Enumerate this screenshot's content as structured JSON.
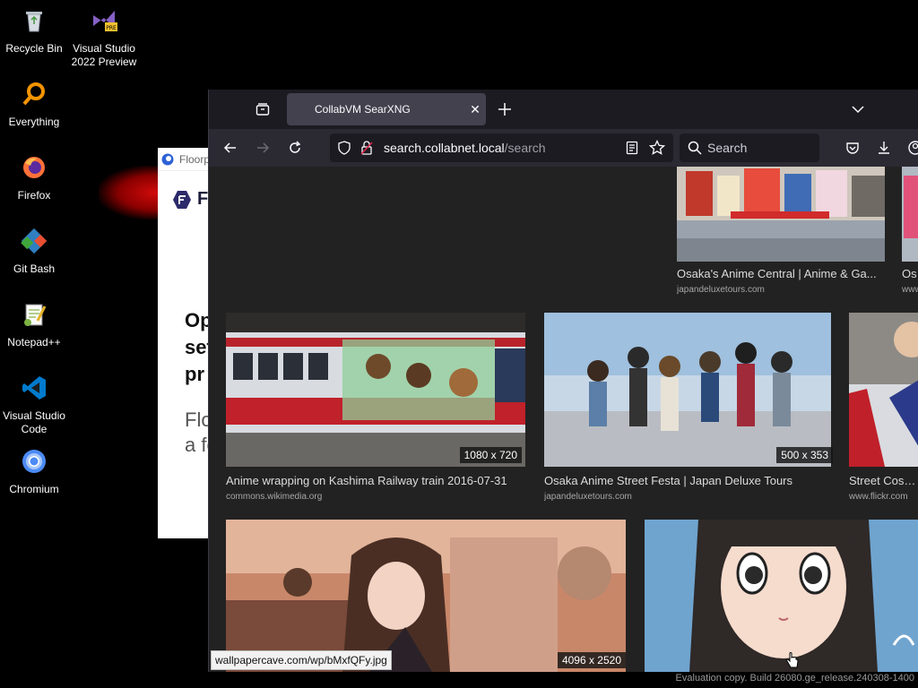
{
  "desktop": {
    "icons": [
      {
        "label": "Recycle Bin"
      },
      {
        "label": "Visual Studio 2022 Preview",
        "badge": "PRE"
      },
      {
        "label": "Everything"
      },
      {
        "label": "Firefox"
      },
      {
        "label": "Git Bash"
      },
      {
        "label": "Notepad++"
      },
      {
        "label": "Visual Studio Code"
      },
      {
        "label": "Chromium"
      }
    ]
  },
  "floorp": {
    "title": "Floorp",
    "logo_letter": "F",
    "headline": "Op\nset\npr",
    "subtext": "Flo\na fe"
  },
  "browser": {
    "tab": {
      "title": "CollabVM SearXNG"
    },
    "url": {
      "domain": "search.collabnet.local",
      "path": "/search"
    },
    "search_placeholder": "Search",
    "results": [
      {
        "title": "Osaka's Anime Central | Anime & Ga...",
        "source": "japandeluxetours.com",
        "resolution": ""
      },
      {
        "title": "Os",
        "source": "www",
        "resolution": ""
      },
      {
        "title": "Anime wrapping on Kashima Railway train 2016-07-31",
        "source": "commons.wikimedia.org",
        "resolution": "1080 x 720"
      },
      {
        "title": "Osaka Anime Street Festa | Japan Deluxe Tours",
        "source": "japandeluxetours.com",
        "resolution": "500 x 353"
      },
      {
        "title": "Street Cospla",
        "source": "www.flickr.com",
        "resolution": ""
      },
      {
        "title": "",
        "source": "",
        "resolution": "4096 x 2520"
      },
      {
        "title": "",
        "source": "",
        "resolution": ""
      }
    ],
    "status_url": "wallpapercave.com/wp/bMxfQFy.jpg"
  },
  "watermark": "Evaluation copy. Build 26080.ge_release.240308-1400",
  "colors": {
    "browser_bg": "#1c1b22",
    "toolbar": "#2b2a33",
    "active_tab": "#42414d",
    "content_bg": "#222222"
  }
}
